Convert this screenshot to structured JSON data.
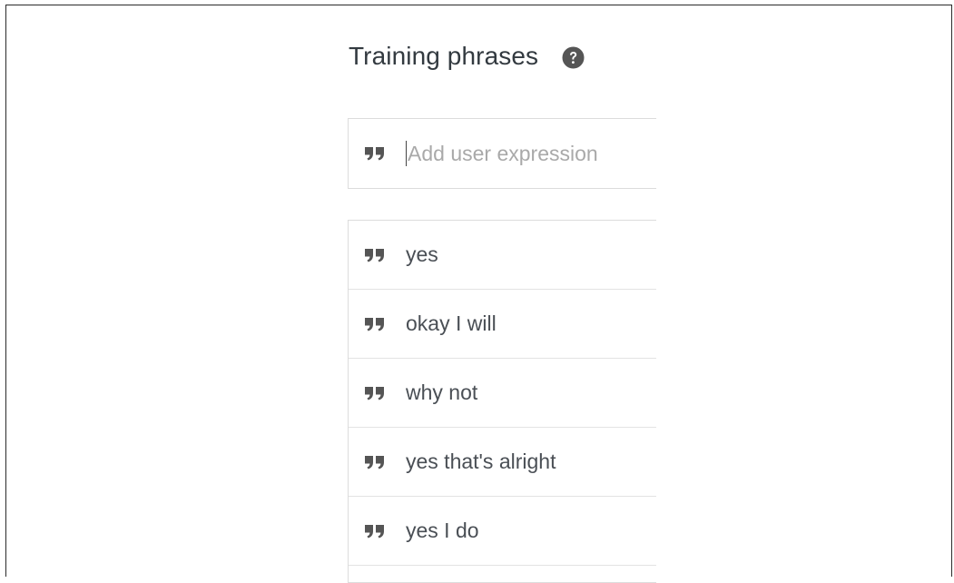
{
  "section": {
    "title": "Training phrases",
    "help_icon": "question-circle-icon"
  },
  "input": {
    "placeholder": "Add user expression",
    "value": "",
    "icon": "quote-icon"
  },
  "phrases": [
    {
      "text": "yes"
    },
    {
      "text": "okay I will"
    },
    {
      "text": "why not"
    },
    {
      "text": "yes that's alright"
    },
    {
      "text": "yes I do"
    }
  ],
  "colors": {
    "icon": "#555555",
    "text": "#4a4f55",
    "placeholder": "#a9a9a9",
    "border": "#dcdcdc"
  }
}
